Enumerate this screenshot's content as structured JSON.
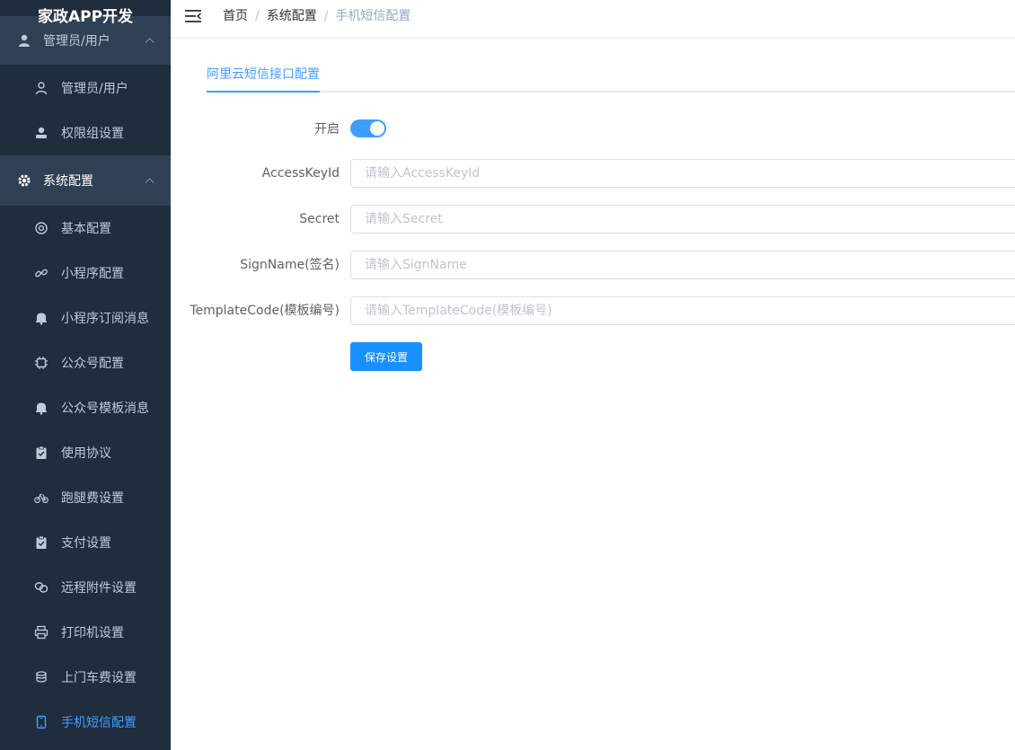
{
  "app": {
    "brand": "家政APP开发"
  },
  "sidebar": {
    "group_top": {
      "label": "管理员/用户",
      "icon": "admin-user-icon"
    },
    "items_a": [
      {
        "label": "管理员/用户",
        "icon": "user-icon"
      },
      {
        "label": "权限组设置",
        "icon": "role-icon"
      }
    ],
    "group_system": {
      "label": "系统配置",
      "icon": "gear-icon"
    },
    "items_b": [
      {
        "label": "基本配置",
        "icon": "settings-icon"
      },
      {
        "label": "小程序配置",
        "icon": "link-icon"
      },
      {
        "label": "小程序订阅消息",
        "icon": "bell-icon"
      },
      {
        "label": "公众号配置",
        "icon": "chip-icon"
      },
      {
        "label": "公众号模板消息",
        "icon": "bell-icon"
      },
      {
        "label": "使用协议",
        "icon": "clipboard-check-icon"
      },
      {
        "label": "跑腿费设置",
        "icon": "bicycle-icon"
      },
      {
        "label": "支付设置",
        "icon": "clipboard-check-icon"
      },
      {
        "label": "远程附件设置",
        "icon": "attachment-icon"
      },
      {
        "label": "打印机设置",
        "icon": "printer-icon"
      },
      {
        "label": "上门车费设置",
        "icon": "car-fee-icon"
      },
      {
        "label": "手机短信配置",
        "icon": "mobile-icon"
      }
    ]
  },
  "header": {
    "breadcrumb": [
      "首页",
      "系统配置",
      "手机短信配置"
    ],
    "separator": "/"
  },
  "tabs": [
    {
      "label": "阿里云短信接口配置",
      "active": true
    }
  ],
  "form": {
    "enable": {
      "label": "开启",
      "value": true
    },
    "fields": [
      {
        "label": "AccessKeyId",
        "placeholder": "请输入AccessKeyId",
        "value": ""
      },
      {
        "label": "Secret",
        "placeholder": "请输入Secret",
        "value": ""
      },
      {
        "label": "SignName(签名)",
        "placeholder": "请输入SignName",
        "value": ""
      },
      {
        "label": "TemplateCode(模板编号)",
        "placeholder": "请输入TemplateCode(模板编号)",
        "value": ""
      }
    ],
    "save_label": "保存设置"
  },
  "colors": {
    "sidebar_bg": "#1f2d3d",
    "sidebar_group_bg": "#304156",
    "sidebar_text": "#bfcbd9",
    "accent": "#409eff",
    "button": "#1890ff"
  }
}
